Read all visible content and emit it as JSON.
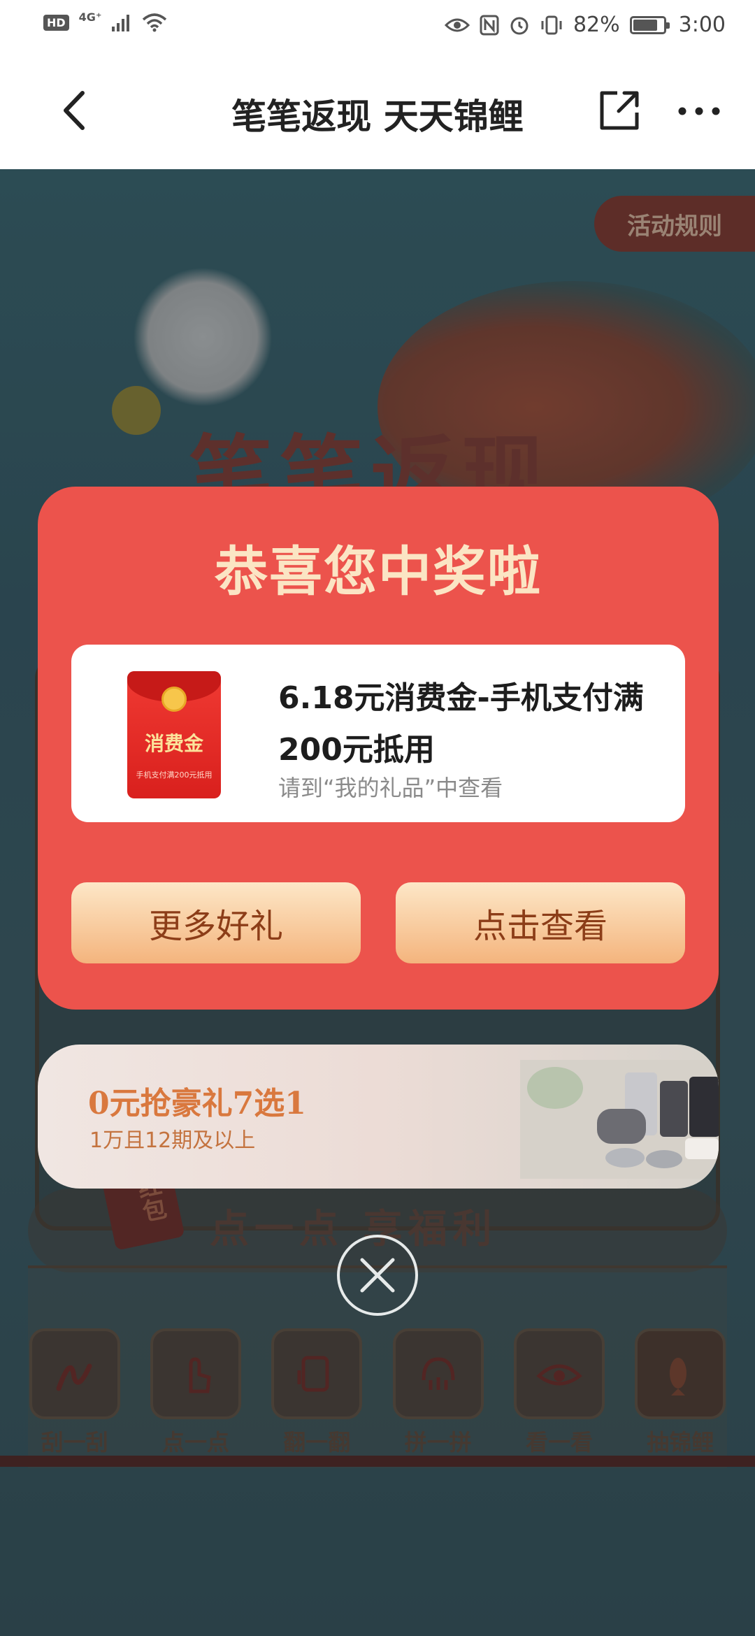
{
  "status_bar": {
    "hd": "HD",
    "network": "4G⁺",
    "battery": "82%",
    "battery_level": 0.82,
    "time": "3:00"
  },
  "nav": {
    "title": "笔笔返现 天天锦鲤",
    "back_icon": "chevron-left-icon",
    "share_icon": "share-icon",
    "more_icon": "more-icon"
  },
  "background": {
    "rules_label": "活动规则",
    "main_title": "笔笔返现",
    "banner_text": "点一点 享福利",
    "hongbao_text": "红包",
    "tools": [
      {
        "label": "刮一刮",
        "icon": "scratch-icon"
      },
      {
        "label": "点一点",
        "icon": "tap-icon"
      },
      {
        "label": "翻一翻",
        "icon": "flip-icon"
      },
      {
        "label": "拼一拼",
        "icon": "puzzle-icon"
      },
      {
        "label": "看一看",
        "icon": "eye-icon"
      },
      {
        "label": "抽锦鲤",
        "icon": "koi-icon"
      }
    ]
  },
  "modal": {
    "title": "恭喜您中奖啦",
    "prize": {
      "envelope_label": "消费金",
      "envelope_sub": "手机支付满200元抵用",
      "name": "6.18元消费金-手机支付满200元抵用",
      "hint": "请到“我的礼品”中查看"
    },
    "more_gifts_label": "更多好礼",
    "view_label": "点击查看"
  },
  "promo": {
    "title": "0元抢豪礼7选1",
    "subtitle": "1万且12期及以上"
  },
  "colors": {
    "modal_red": "#ec534c",
    "title_cream": "#fbe5c4",
    "button_text": "#8c3d18",
    "promo_orange": "#d9783e"
  }
}
